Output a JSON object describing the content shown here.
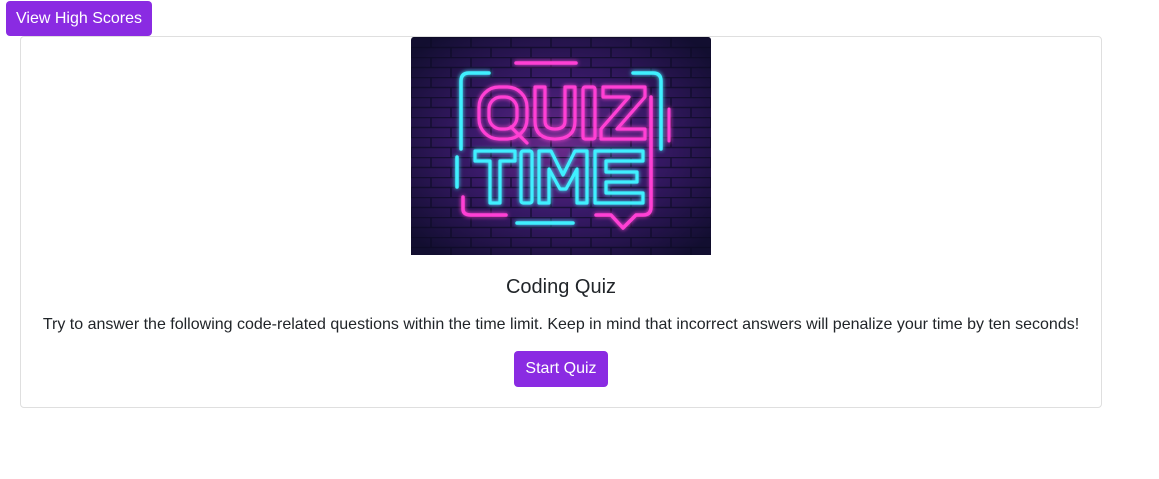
{
  "header": {
    "high_scores_label": "View High Scores"
  },
  "card": {
    "image": {
      "line1": "QUIZ",
      "line2": "TIME"
    },
    "title": "Coding Quiz",
    "description": "Try to answer the following code-related questions within the time limit. Keep in mind that incorrect answers will penalize your time by ten seconds!",
    "start_label": "Start Quiz"
  },
  "colors": {
    "accent": "#8a2be2",
    "neon_pink": "#ff3fd4",
    "neon_cyan": "#3ff0ff",
    "brick_dark": "#1a1440"
  }
}
